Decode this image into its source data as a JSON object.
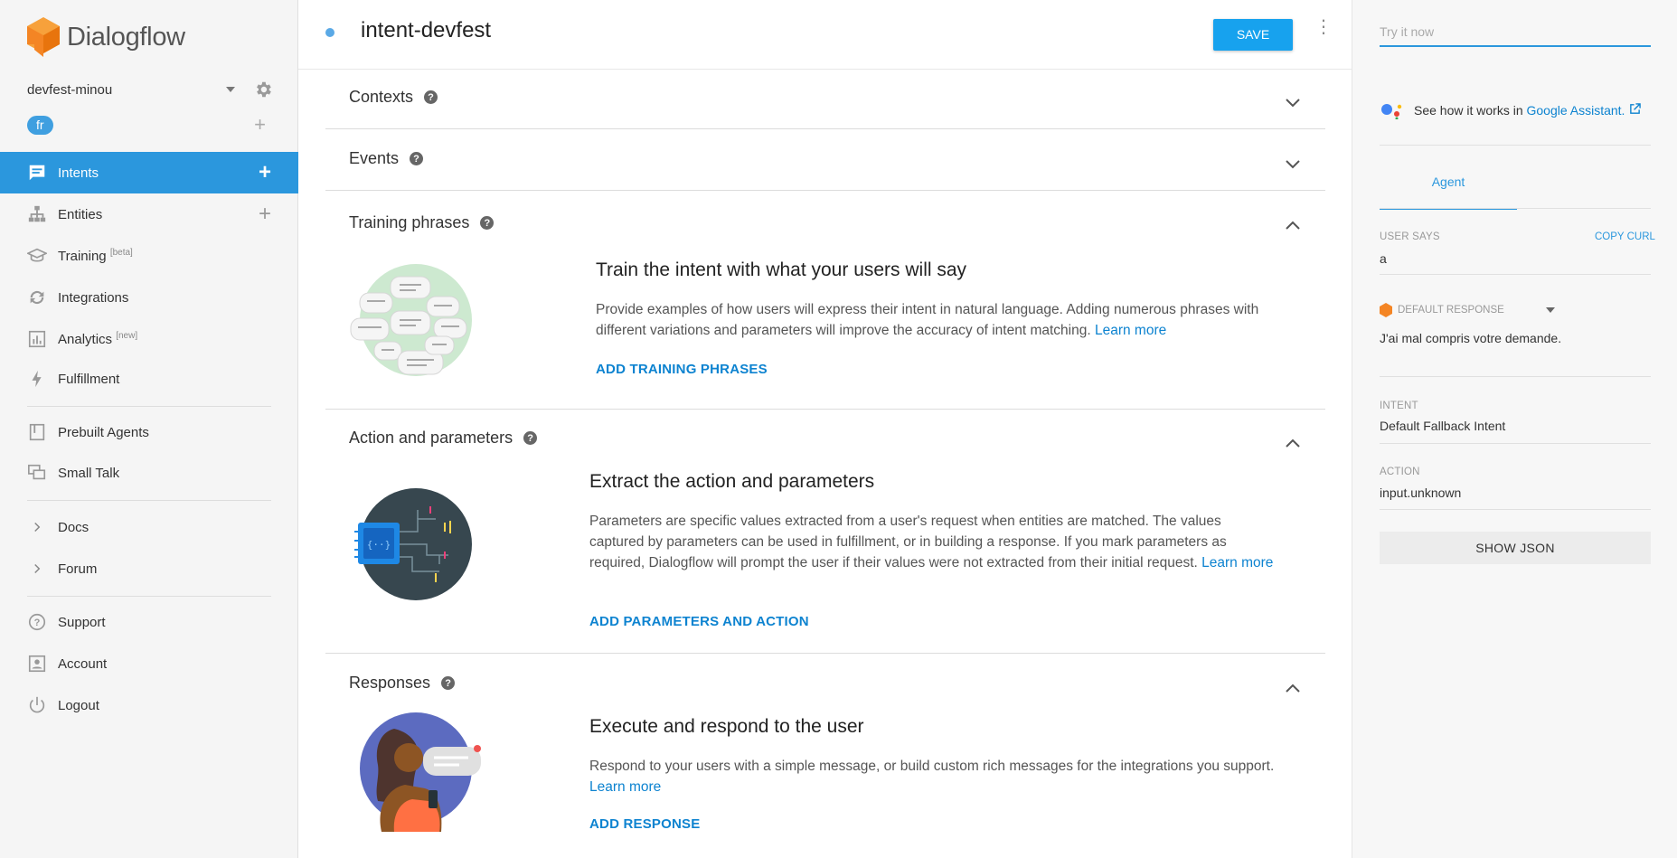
{
  "app": {
    "logo_text": "Dialogflow"
  },
  "sidebar": {
    "agent_name": "devfest-minou",
    "language": "fr",
    "items": [
      {
        "label": "Intents",
        "icon": "chat-bubble-icon",
        "active": true
      },
      {
        "label": "Entities",
        "icon": "hierarchy-icon"
      },
      {
        "label": "Training",
        "sup": "[beta]",
        "icon": "graduation-cap-icon"
      },
      {
        "label": "Integrations",
        "icon": "sync-icon"
      },
      {
        "label": "Analytics",
        "sup": "[new]",
        "icon": "bar-chart-icon"
      },
      {
        "label": "Fulfillment",
        "icon": "lightning-icon"
      },
      {
        "label": "Prebuilt Agents",
        "icon": "book-icon"
      },
      {
        "label": "Small Talk",
        "icon": "chat-squares-icon"
      },
      {
        "label": "Docs",
        "icon": "chevron-right-icon"
      },
      {
        "label": "Forum",
        "icon": "chevron-right-icon"
      },
      {
        "label": "Support",
        "icon": "question-circle-icon"
      },
      {
        "label": "Account",
        "icon": "person-card-icon"
      },
      {
        "label": "Logout",
        "icon": "power-icon"
      }
    ]
  },
  "header": {
    "intent_name": "intent-devfest",
    "save_label": "SAVE"
  },
  "sections": {
    "contexts": {
      "title": "Contexts"
    },
    "events": {
      "title": "Events"
    },
    "training": {
      "title": "Training phrases",
      "card_title": "Train the intent with what your users will say",
      "desc": "Provide examples of how users will express their intent in natural language. Adding numerous phrases with different variations and parameters will improve the accuracy of intent matching.",
      "learn_more": "Learn more",
      "action": "ADD TRAINING PHRASES"
    },
    "action": {
      "title": "Action and parameters",
      "card_title": "Extract the action and parameters",
      "desc": "Parameters are specific values extracted from a user's request when entities are matched. The values captured by parameters can be used in fulfillment, or in building a response. If you mark parameters as required, Dialogflow will prompt the user if their values were not extracted from their initial request.",
      "learn_more": "Learn more",
      "action": "ADD PARAMETERS AND ACTION"
    },
    "responses": {
      "title": "Responses",
      "card_title": "Execute and respond to the user",
      "desc": "Respond to your users with a simple message, or build custom rich messages for the integrations you support.",
      "learn_more": "Learn more",
      "action": "ADD RESPONSE"
    }
  },
  "right_panel": {
    "try_placeholder": "Try it now",
    "ga_text": "See how it works in",
    "ga_link": "Google Assistant.",
    "tab": "Agent",
    "user_says_label": "USER SAYS",
    "copy_curl": "COPY CURL",
    "user_says_value": "a",
    "default_response_label": "DEFAULT RESPONSE",
    "default_response_value": "J'ai mal compris votre demande.",
    "intent_label": "INTENT",
    "intent_value": "Default Fallback Intent",
    "action_label": "ACTION",
    "action_value": "input.unknown",
    "show_json": "SHOW JSON"
  },
  "colors": {
    "accent": "#2b97dd",
    "save": "#17a2ee",
    "link": "#0d83d0",
    "logo": "#f48524"
  }
}
